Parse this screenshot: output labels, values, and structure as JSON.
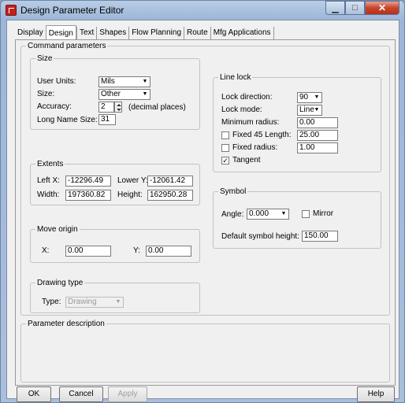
{
  "window": {
    "title": "Design Parameter Editor"
  },
  "tabs": [
    "Display",
    "Design",
    "Text",
    "Shapes",
    "Flow Planning",
    "Route",
    "Mfg Applications"
  ],
  "command_parameters": "Command parameters",
  "size": {
    "legend": "Size",
    "user_units_label": "User Units:",
    "user_units_value": "Mils",
    "size_label": "Size:",
    "size_value": "Other",
    "accuracy_label": "Accuracy:",
    "accuracy_value": "2",
    "accuracy_unit": "(decimal places)",
    "long_name_label": "Long Name Size:",
    "long_name_value": "31"
  },
  "extents": {
    "legend": "Extents",
    "left_x_label": "Left X:",
    "left_x": "-12296.49",
    "lower_y_label": "Lower Y:",
    "lower_y": "-12061.42",
    "width_label": "Width:",
    "width": "197360.82",
    "height_label": "Height:",
    "height": "162950.28"
  },
  "move_origin": {
    "legend": "Move origin",
    "x_label": "X:",
    "x": "0.00",
    "y_label": "Y:",
    "y": "0.00"
  },
  "drawing_type": {
    "legend": "Drawing type",
    "type_label": "Type:",
    "type_value": "Drawing"
  },
  "line_lock": {
    "legend": "Line lock",
    "lock_direction_label": "Lock direction:",
    "lock_direction": "90",
    "lock_mode_label": "Lock mode:",
    "lock_mode": "Line",
    "min_radius_label": "Minimum radius:",
    "min_radius": "0.00",
    "fixed45_label": "Fixed 45 Length:",
    "fixed45": "25.00",
    "fixed_radius_label": "Fixed radius:",
    "fixed_radius": "1.00",
    "tangent_label": "Tangent",
    "tangent_checked": "✓"
  },
  "symbol": {
    "legend": "Symbol",
    "angle_label": "Angle:",
    "angle": "0.000",
    "mirror_label": "Mirror",
    "default_height_label": "Default symbol height:",
    "default_height": "150.00"
  },
  "parameter_description": {
    "legend": "Parameter description"
  },
  "buttons": {
    "ok": "OK",
    "cancel": "Cancel",
    "apply": "Apply",
    "help": "Help"
  }
}
